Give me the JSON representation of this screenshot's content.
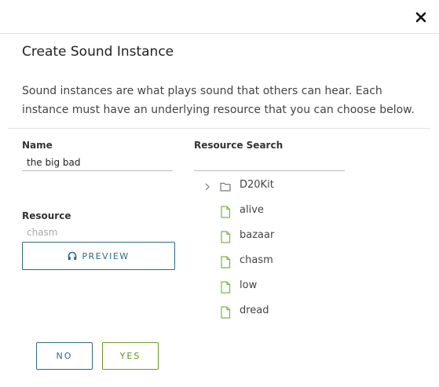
{
  "dialog": {
    "close_icon": "close-icon",
    "title": "Create Sound Instance",
    "description": "Sound instances are what plays sound that others can hear. Each instance must have an underlying resource that you can choose below."
  },
  "form": {
    "name_label": "Name",
    "name_value": "the big bad",
    "resource_label": "Resource",
    "resource_value": "chasm",
    "preview_icon": "headphones-icon",
    "preview_label": "PREVIEW"
  },
  "resource_search": {
    "label": "Resource Search",
    "value": "",
    "tree": [
      {
        "label": "D20Kit",
        "type": "folder",
        "icon": "folder-icon",
        "expandable": true
      },
      {
        "label": "alive",
        "type": "file",
        "icon": "file-icon"
      },
      {
        "label": "bazaar",
        "type": "file",
        "icon": "file-icon"
      },
      {
        "label": "chasm",
        "type": "file",
        "icon": "file-icon"
      },
      {
        "label": "low",
        "type": "file",
        "icon": "file-icon"
      },
      {
        "label": "dread",
        "type": "file",
        "icon": "file-icon"
      }
    ]
  },
  "actions": {
    "no_label": "NO",
    "yes_label": "YES"
  },
  "colors": {
    "accent_blue": "#2c6a82",
    "accent_green": "#6b9a2a",
    "file_icon_green": "#7cb342",
    "folder_icon_gray": "#777777"
  }
}
